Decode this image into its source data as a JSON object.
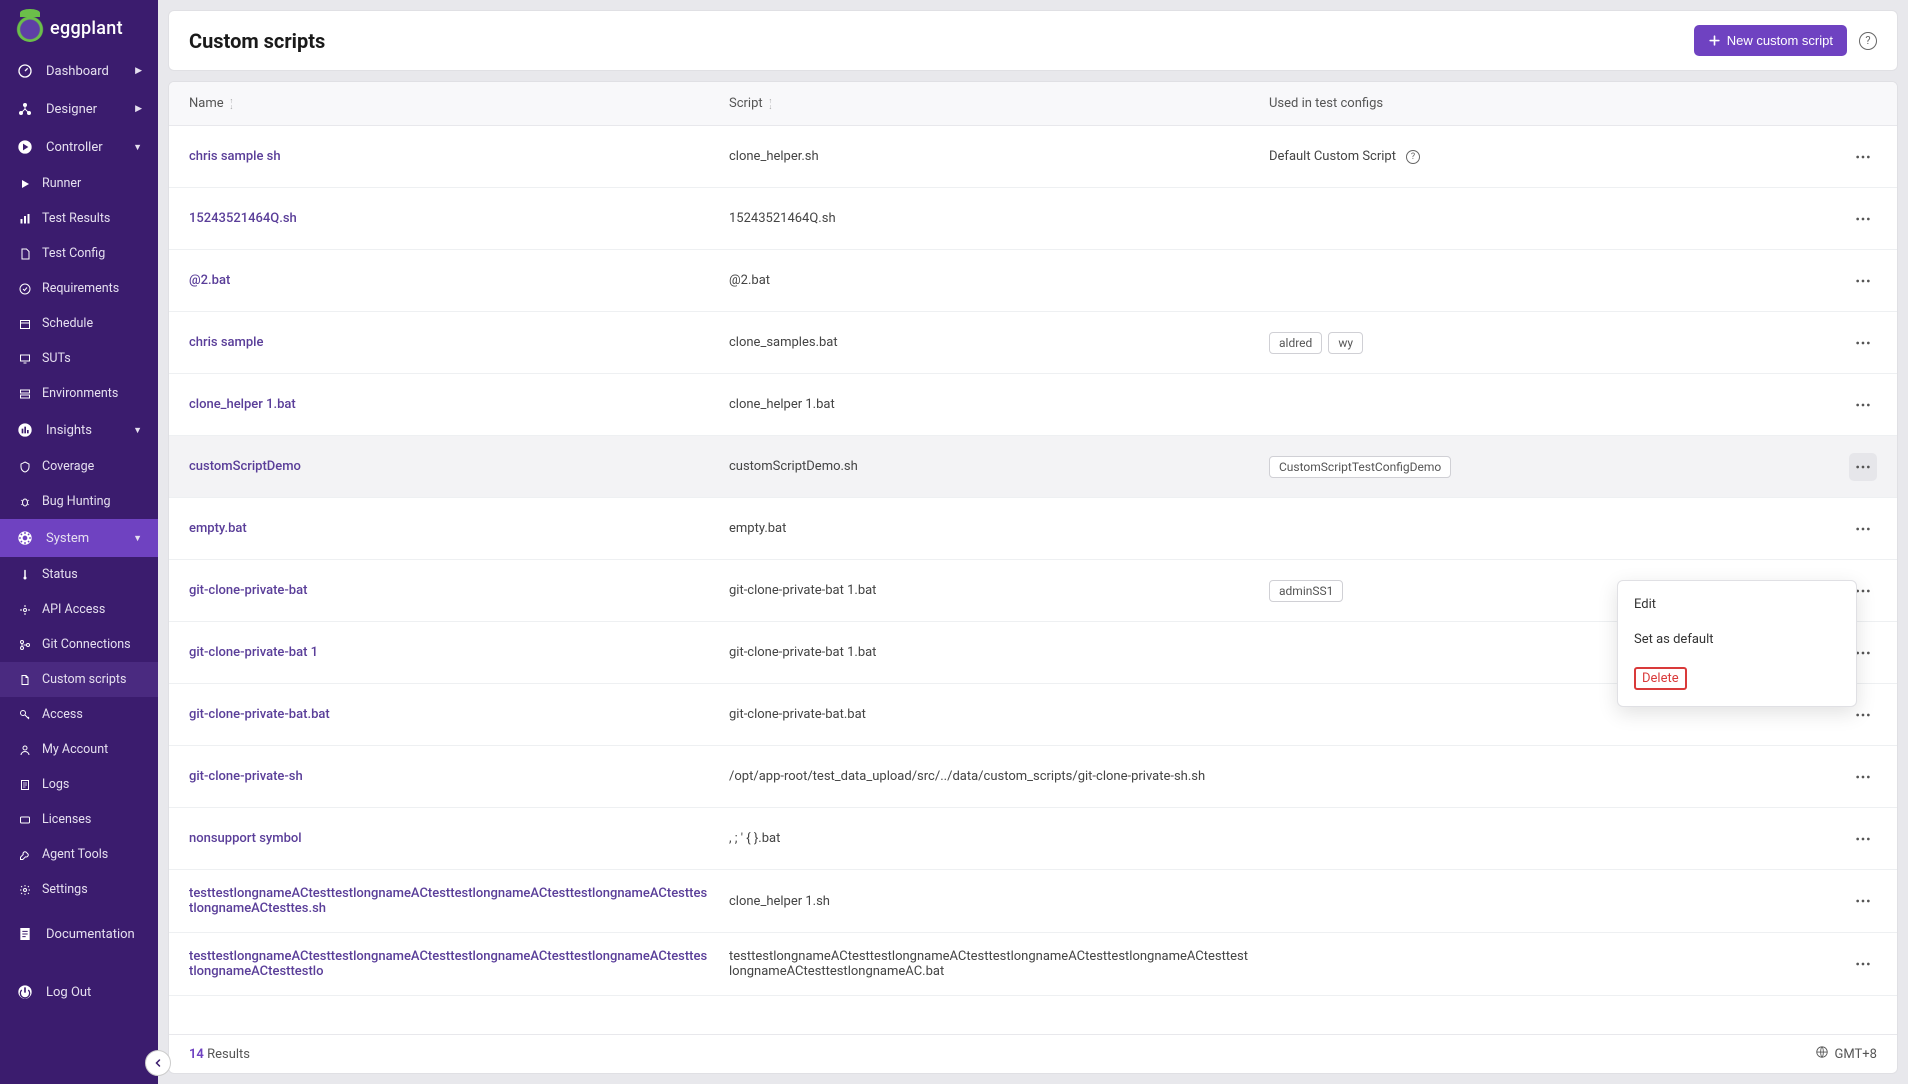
{
  "logo_text": "eggplant",
  "nav": {
    "dashboard": "Dashboard",
    "designer": "Designer",
    "controller": "Controller",
    "runner": "Runner",
    "test_results": "Test Results",
    "test_config": "Test Config",
    "requirements": "Requirements",
    "schedule": "Schedule",
    "suts": "SUTs",
    "environments": "Environments",
    "insights": "Insights",
    "coverage": "Coverage",
    "bug_hunting": "Bug Hunting",
    "system": "System",
    "status": "Status",
    "api_access": "API Access",
    "git_connections": "Git Connections",
    "custom_scripts": "Custom scripts",
    "access": "Access",
    "my_account": "My Account",
    "logs": "Logs",
    "licenses": "Licenses",
    "agent_tools": "Agent Tools",
    "settings": "Settings",
    "documentation": "Documentation",
    "logout": "Log Out"
  },
  "page": {
    "title": "Custom scripts",
    "new_button": "New custom script"
  },
  "columns": {
    "name": "Name",
    "script": "Script",
    "used": "Used in test configs"
  },
  "rows": [
    {
      "name": "chris sample sh",
      "script": "clone_helper.sh",
      "used_text": "Default Custom Script",
      "used_tags": [],
      "info": true
    },
    {
      "name": "15243521464Q.sh",
      "script": "15243521464Q.sh",
      "used_text": "",
      "used_tags": []
    },
    {
      "name": "@2.bat",
      "script": "@2.bat",
      "used_text": "",
      "used_tags": []
    },
    {
      "name": "chris sample",
      "script": "clone_samples.bat",
      "used_text": "",
      "used_tags": [
        "aldred",
        "wy"
      ]
    },
    {
      "name": "clone_helper 1.bat",
      "script": "clone_helper 1.bat",
      "used_text": "",
      "used_tags": []
    },
    {
      "name": "customScriptDemo",
      "script": "customScriptDemo.sh",
      "used_text": "",
      "used_tags": [
        "CustomScriptTestConfigDemo"
      ],
      "hover": true,
      "menu_open": true
    },
    {
      "name": "empty.bat",
      "script": "empty.bat",
      "used_text": "",
      "used_tags": []
    },
    {
      "name": "git-clone-private-bat",
      "script": "git-clone-private-bat 1.bat",
      "used_text": "",
      "used_tags": [
        "adminSS1"
      ]
    },
    {
      "name": "git-clone-private-bat 1",
      "script": "git-clone-private-bat 1.bat",
      "used_text": "",
      "used_tags": []
    },
    {
      "name": "git-clone-private-bat.bat",
      "script": "git-clone-private-bat.bat",
      "used_text": "",
      "used_tags": []
    },
    {
      "name": "git-clone-private-sh",
      "script": "/opt/app-root/test_data_upload/src/../data/custom_scripts/git-clone-private-sh.sh",
      "used_text": "",
      "used_tags": []
    },
    {
      "name": "nonsupport symbol",
      "script": ", ; ' { }.bat",
      "used_text": "",
      "used_tags": []
    },
    {
      "name": "testtestlongnameACtesttestlongnameACtesttestlongnameACtesttestlongnameACtesttestlongnameACtesttes.sh",
      "script": "clone_helper 1.sh",
      "used_text": "",
      "used_tags": []
    },
    {
      "name": "testtestlongnameACtesttestlongnameACtesttestlongnameACtesttestlongnameACtesttestlongnameACtesttestlo",
      "script": "testtestlongnameACtesttestlongnameACtesttestlongnameACtesttestlongnameACtesttestlongnameACtesttestlongnameAC.bat",
      "used_text": "",
      "used_tags": []
    }
  ],
  "footer": {
    "count": "14",
    "results_label": "Results",
    "timezone": "GMT+8"
  },
  "menu": {
    "edit": "Edit",
    "set_default": "Set as default",
    "delete": "Delete"
  }
}
